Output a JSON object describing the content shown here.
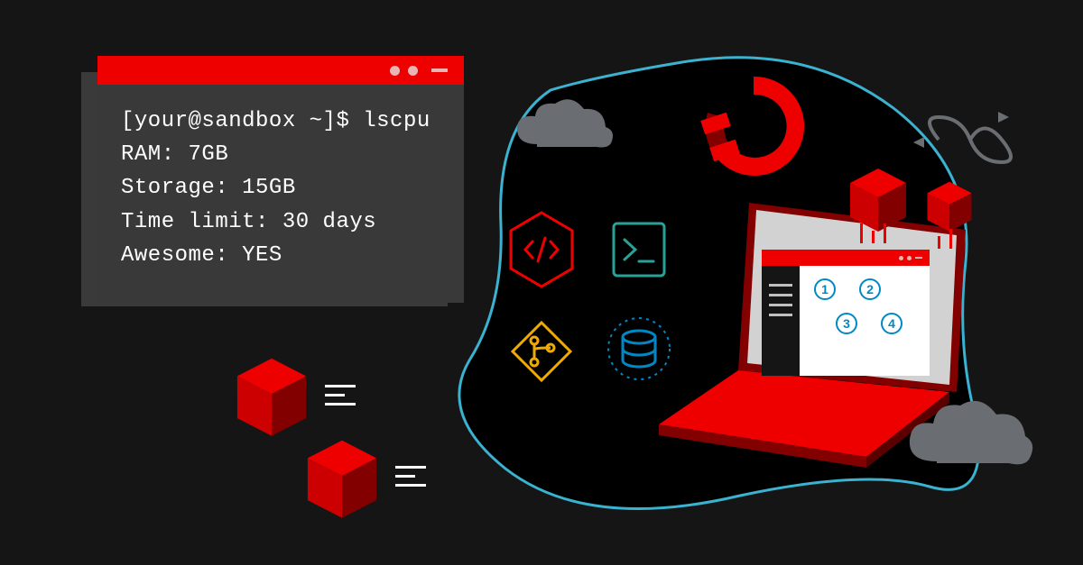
{
  "terminal": {
    "prompt": "[your@sandbox ~]$ lscpu",
    "lines": [
      "RAM: 7GB",
      "Storage: 15GB",
      "Time limit: 30 days",
      "Awesome: YES"
    ]
  },
  "icons": {
    "code": "code-brackets-icon",
    "terminal": "terminal-prompt-icon",
    "git": "git-branch-icon",
    "database": "database-stack-icon",
    "openshift": "openshift-logo-icon",
    "infinity": "infinity-loop-icon",
    "cube": "cube-icon",
    "cloud": "cloud-icon",
    "laptop": "laptop-icon"
  },
  "laptop_steps": [
    "1",
    "2",
    "3",
    "4"
  ],
  "colors": {
    "brand_red": "#ee0000",
    "dark_gray": "#393939",
    "teal": "#2aa198",
    "orange": "#f0ab00",
    "blue": "#0088c6",
    "cloud_gray": "#6a6e73"
  }
}
